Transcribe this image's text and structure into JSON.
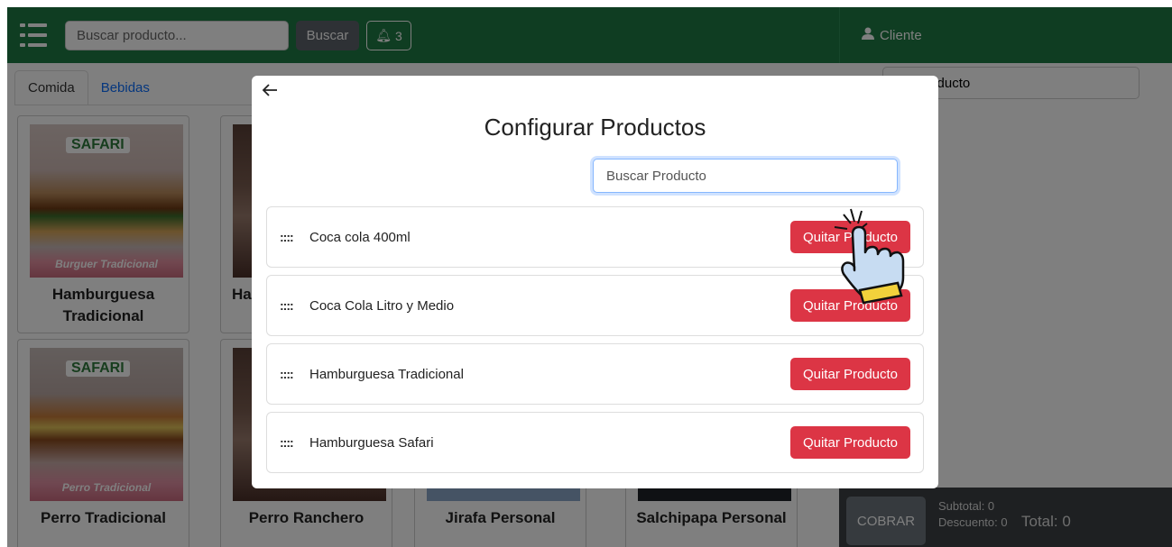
{
  "topbar": {
    "search_placeholder": "Buscar producto...",
    "search_button": "Buscar",
    "notification_count": "3",
    "client_label": "Cliente"
  },
  "tabs": [
    {
      "label": "Comida"
    },
    {
      "label": "Bebidas"
    }
  ],
  "products": [
    {
      "name": "Hamburguesa Tradicional",
      "logo": "SAFARI",
      "subtitle": "Burguer Tradicional"
    },
    {
      "name": "Ha",
      "logo": "",
      "subtitle": ""
    },
    {
      "name": "Perro Tradicional",
      "logo": "SAFARI",
      "subtitle": "Perro Tradicional"
    },
    {
      "name": "Perro Ranchero",
      "logo": "",
      "subtitle": ""
    },
    {
      "name": "Jirafa Personal",
      "logo": "",
      "subtitle": ""
    },
    {
      "name": "Salchipapa Personal",
      "logo": "",
      "subtitle": ""
    }
  ],
  "right_panel": {
    "product_input_text": "del Producto",
    "cobrar_label": "COBRAR",
    "subtotal": "Subtotal: 0",
    "descuento": "Descuento: 0",
    "total": "Total: 0"
  },
  "modal": {
    "title": "Configurar Productos",
    "search_placeholder": "Buscar Producto",
    "drag_handle": "::::",
    "items": [
      {
        "label": "Coca cola 400ml",
        "button": "Quitar Producto"
      },
      {
        "label": "Coca Cola Litro y Medio",
        "button": "Quitar Producto"
      },
      {
        "label": "Hamburguesa Tradicional",
        "button": "Quitar Producto"
      },
      {
        "label": "Hamburguesa Safari",
        "button": "Quitar Producto"
      }
    ]
  },
  "colors": {
    "topbar": "#1f7a45",
    "danger": "#dc3545",
    "link": "#0d6efd"
  }
}
